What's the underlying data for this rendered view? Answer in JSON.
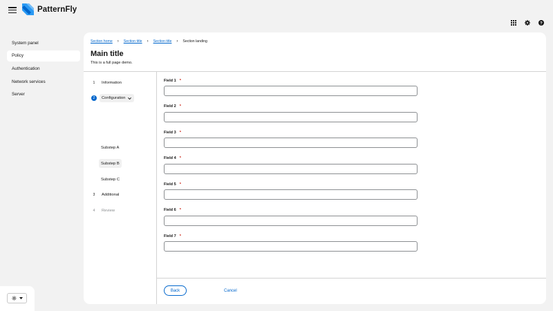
{
  "masthead": {
    "brand": "PatternFly",
    "icons": [
      "hamburger-menu-icon",
      "app-grid-icon",
      "settings-gear-icon",
      "help-question-icon"
    ]
  },
  "sidebar": {
    "items": [
      {
        "label": "System panel",
        "active": false
      },
      {
        "label": "Policy",
        "active": true
      },
      {
        "label": "Authentication",
        "active": false
      },
      {
        "label": "Network services",
        "active": false
      },
      {
        "label": "Server",
        "active": false
      }
    ]
  },
  "theme": {
    "icon": "sun-icon"
  },
  "breadcrumb": {
    "items": [
      "Section home",
      "Section title",
      "Section title"
    ],
    "current": "Section landing"
  },
  "page": {
    "title": "Main title",
    "subtitle": "This is a full page demo."
  },
  "wizard": {
    "steps": [
      {
        "num": "1",
        "label": "Information"
      },
      {
        "num": "2",
        "label": "Configuration"
      },
      {
        "num": "3",
        "label": "Additional"
      },
      {
        "num": "4",
        "label": "Review"
      }
    ],
    "substeps": [
      "Substep A",
      "Substep B",
      "Substep C"
    ]
  },
  "form": {
    "fields": [
      {
        "label": "Field 1",
        "required": "*",
        "value": ""
      },
      {
        "label": "Field 2",
        "required": "*",
        "value": ""
      },
      {
        "label": "Field 3",
        "required": "*",
        "value": ""
      },
      {
        "label": "Field 4",
        "required": "*",
        "value": ""
      },
      {
        "label": "Field 5",
        "required": "*",
        "value": ""
      },
      {
        "label": "Field 6",
        "required": "*",
        "value": ""
      },
      {
        "label": "Field 7",
        "required": "*",
        "value": ""
      }
    ],
    "back_label": "Back",
    "cancel_label": "Cancel"
  },
  "colors": {
    "accent": "#0066cc",
    "required": "#c9190b",
    "background": "#f2f2f2",
    "surface": "#ffffff"
  }
}
